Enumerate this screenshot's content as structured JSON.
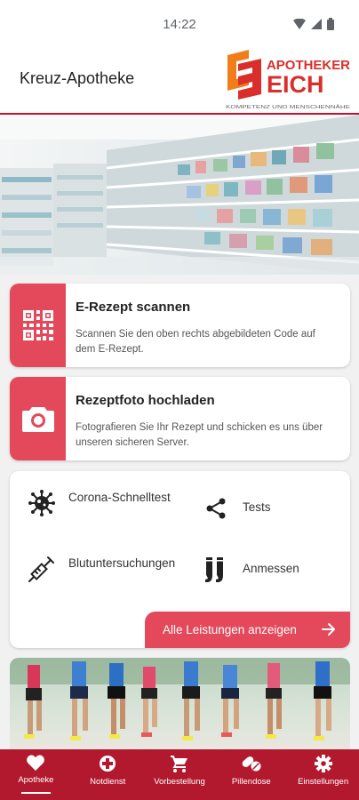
{
  "status_bar": {
    "time": "14:22"
  },
  "header": {
    "title": "Kreuz-Apotheke",
    "logo": {
      "line1": "APOTHEKER",
      "line2": "EICH",
      "tagline": "KOMPETENZ UND MENSCHENNÄHE",
      "brand_color": "#d92e2b",
      "accent_color": "#f07d1a"
    }
  },
  "cards": [
    {
      "title": "E-Rezept scannen",
      "description": "Scannen Sie den oben rechts abgebildeten Code auf dem E-Rezept.",
      "icon": "qr-code-icon"
    },
    {
      "title": "Rezeptfoto hochladen",
      "description": "Fotografieren Sie Ihr Rezept und schicken es uns über unseren sicheren Server.",
      "icon": "camera-icon"
    }
  ],
  "services": {
    "items": [
      {
        "label": "Corona-Schnelltest",
        "icon": "virus-icon"
      },
      {
        "label": "Tests",
        "icon": "share-icon"
      },
      {
        "label": "Blutuntersuchungen",
        "icon": "syringe-icon"
      },
      {
        "label": "Anmessen",
        "icon": "stockings-icon"
      }
    ],
    "all_button": "Alle Leistungen anzeigen"
  },
  "nav": {
    "items": [
      {
        "label": "Apotheke",
        "icon": "heart-icon",
        "active": true
      },
      {
        "label": "Notdienst",
        "icon": "emergency-icon",
        "active": false
      },
      {
        "label": "Vorbestellung",
        "icon": "cart-icon",
        "active": false
      },
      {
        "label": "Pillendose",
        "icon": "pills-icon",
        "active": false
      },
      {
        "label": "Einstellungen",
        "icon": "gear-icon",
        "active": false
      }
    ]
  },
  "colors": {
    "primary": "#e3495a",
    "nav": "#b2192e",
    "header_line": "#c8102e"
  }
}
